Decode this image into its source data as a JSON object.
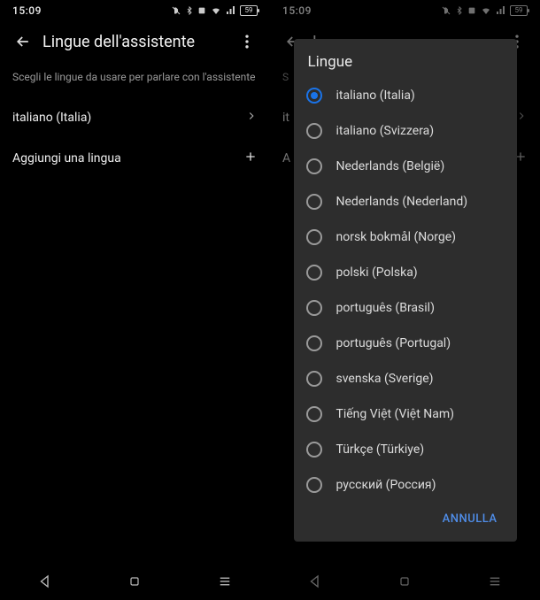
{
  "status": {
    "time": "15:09",
    "battery": "59"
  },
  "left": {
    "title": "Lingue dell'assistente",
    "subtitle": "Scegli le lingue da usare per parlare con l'assistente",
    "current_language": "italiano (Italia)",
    "add_language": "Aggiungi una lingua"
  },
  "right": {
    "title_truncated": "L",
    "subtitle_truncated": "S",
    "current_truncated": "it",
    "add_truncated": "A"
  },
  "dialog": {
    "title": "Lingue",
    "options": [
      {
        "label": "italiano (Italia)",
        "selected": true
      },
      {
        "label": "italiano (Svizzera)",
        "selected": false
      },
      {
        "label": "Nederlands (België)",
        "selected": false
      },
      {
        "label": "Nederlands (Nederland)",
        "selected": false
      },
      {
        "label": "norsk bokmål (Norge)",
        "selected": false
      },
      {
        "label": "polski (Polska)",
        "selected": false
      },
      {
        "label": "português (Brasil)",
        "selected": false
      },
      {
        "label": "português (Portugal)",
        "selected": false
      },
      {
        "label": "svenska (Sverige)",
        "selected": false
      },
      {
        "label": "Tiếng Việt (Việt Nam)",
        "selected": false
      },
      {
        "label": "Türkçe (Türkiye)",
        "selected": false
      },
      {
        "label": "русский (Россия)",
        "selected": false
      }
    ],
    "cancel": "ANNULLA"
  }
}
